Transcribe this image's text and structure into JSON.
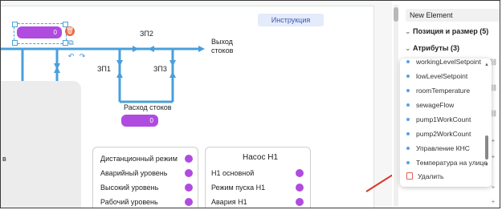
{
  "canvas": {
    "instruction_button": "Инструкция",
    "selected_pill_value": "0",
    "flow_pill_value": "0",
    "labels": {
      "zp2": "ЗП2",
      "zp1": "ЗП1",
      "zp3": "ЗП3",
      "outlet": "Выход\nстоков",
      "flow": "Расход стоков"
    },
    "left_panel_fragment": "в"
  },
  "status_card": {
    "rows": [
      {
        "label": "Дистанционный режим"
      },
      {
        "label": "Аварийный уровень"
      },
      {
        "label": "Высокий уровень"
      },
      {
        "label": "Рабочий уровень"
      }
    ]
  },
  "pump_card": {
    "title": "Насос Н1",
    "rows": [
      {
        "label": "Н1 основной"
      },
      {
        "label": "Режим пуска Н1"
      },
      {
        "label": "Авария Н1"
      }
    ]
  },
  "properties_panel": {
    "element_name": "New Element",
    "sections": [
      {
        "label": "Позиция и размер (5)"
      },
      {
        "label": "Атрибуты (3)"
      }
    ]
  },
  "attribute_dropdown": {
    "items": [
      "workingLevelSetpoint",
      "lowLevelSetpoint",
      "roomTemperature",
      "sewageFlow",
      "pump1WorkCount",
      "pump2WorkCount",
      "Управление КНС",
      "Температура на улице"
    ],
    "delete_label": "Удалить"
  },
  "colors": {
    "pipe": "#4a9fdc",
    "pill": "#b04be0",
    "annotation_arrow": "#d9362b",
    "instruction_bg": "#e4ebfa"
  }
}
